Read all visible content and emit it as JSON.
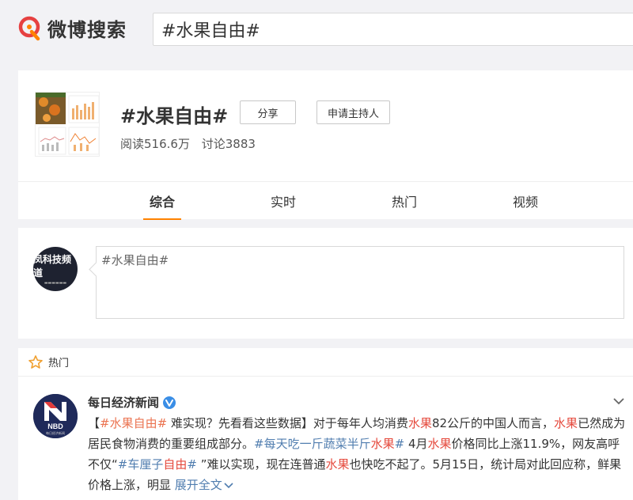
{
  "brand": {
    "logo_text": "微博搜索",
    "accent": "#ff8200",
    "logo_color": "#e64141"
  },
  "search": {
    "value": "#水果自由#"
  },
  "topic": {
    "title": "#水果自由#",
    "share_label": "分享",
    "host_label": "申请主持人",
    "reads": "阅读516.6万",
    "discussions": "讨论3883",
    "tabs": [
      "综合",
      "实时",
      "热门",
      "视频"
    ],
    "active_tab": "综合"
  },
  "compose": {
    "avatar_text": "凤科技频道",
    "textarea_value": "#水果自由#"
  },
  "feed": {
    "section_label": "热门",
    "post": {
      "author": "每日经济新闻",
      "avatar_text": "NBD",
      "avatar_subtext": "每日经济新闻",
      "seg1_open": "【",
      "seg1_tag": "#水果自由#",
      "seg1_text": " 难实现？先看看这些数据】对于每年人均消费",
      "hl1": "水果",
      "seg2": "82公斤的中国人而言，",
      "hl2": "水果",
      "seg3": "已然成为居民食物消费的重要组成部分。",
      "tag2_a": "#每天吃一斤蔬菜半斤",
      "tag2_hl": "水果",
      "tag2_b": "#",
      "seg4": " 4月",
      "hl3": "水果",
      "seg5": "价格同比上涨11.9%，网友高呼不仅“",
      "tag3_a": "#车厘子",
      "tag3_hl": "自由",
      "tag3_b": "#",
      "seg6": " ”难以实现，现在连普通",
      "hl4": "水果",
      "seg7": "也快吃不起了。5月15日，统计局对此回应称，鲜果价格上涨，明显 ",
      "expand": "展开全文"
    }
  }
}
